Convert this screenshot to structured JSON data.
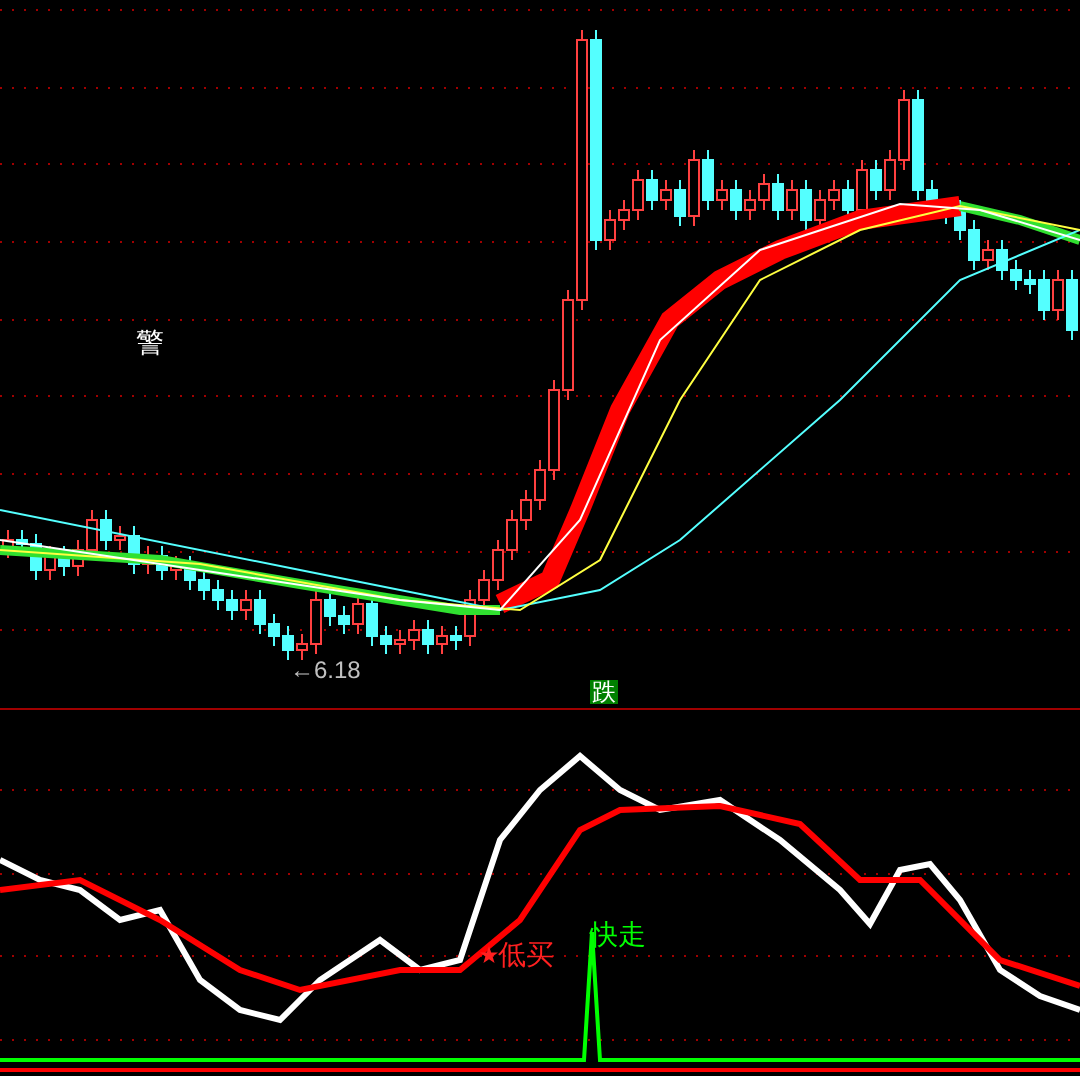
{
  "price_panel": {
    "alert_label": "警",
    "low_marker": "←6.18",
    "signal_badge": "跌"
  },
  "indicator_panel": {
    "buy_signal": "低买",
    "sell_signal": "快走"
  }
}
